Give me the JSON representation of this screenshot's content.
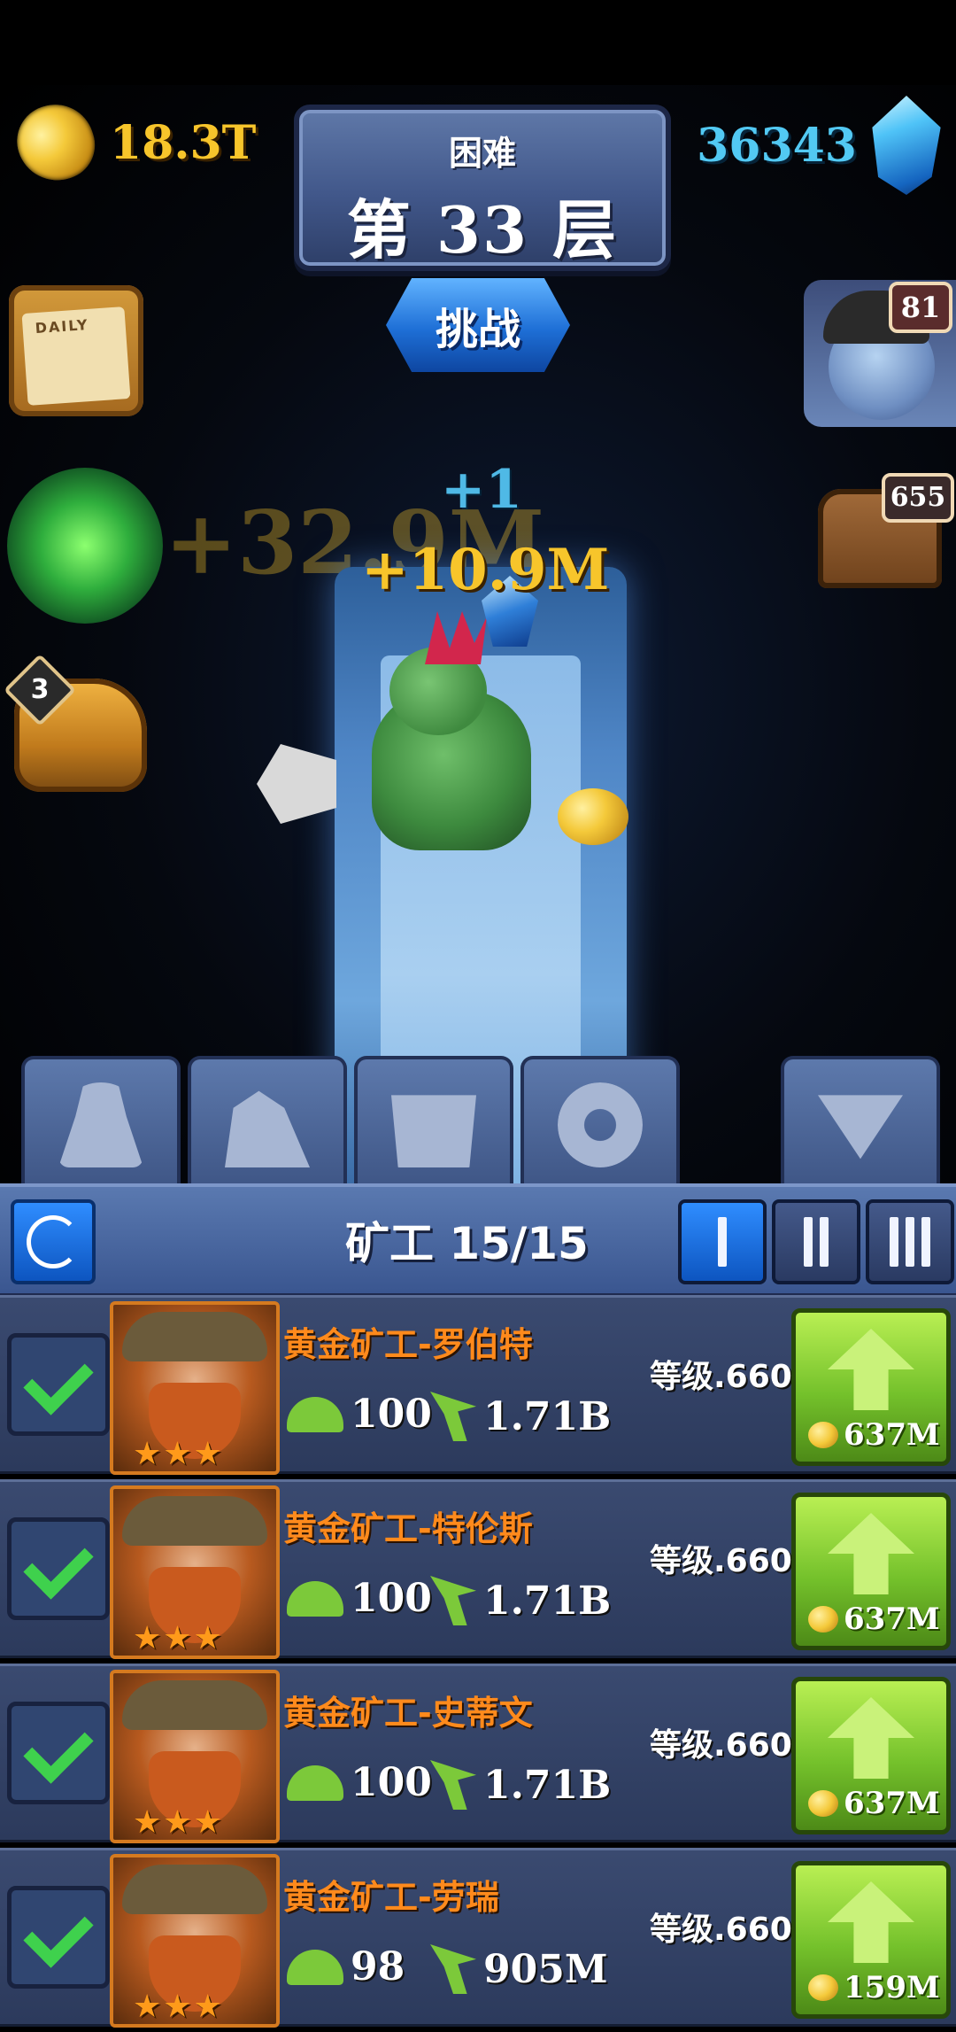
{
  "hud": {
    "gold_amount": "18.3T",
    "gem_amount": "36343",
    "difficulty": "困难",
    "floor": "第 33 层",
    "challenge_label": "挑战"
  },
  "side": {
    "calendar_label": "DAILY",
    "miner_avatar_badge": "81",
    "chest_right_badge": "655",
    "chest_left_badge": "3",
    "ghost_gold": "+32.9M"
  },
  "effects": {
    "plus_gem": "+1",
    "plus_gold": "+10.9M"
  },
  "panel": {
    "title": "矿工  15/15",
    "pages": [
      "I",
      "II",
      "III"
    ]
  },
  "miners": [
    {
      "name": "黄金矿工-罗伯特",
      "helmet": "100",
      "pick": "1.71B",
      "level": "等级.660",
      "cost": "637M"
    },
    {
      "name": "黄金矿工-特伦斯",
      "helmet": "100",
      "pick": "1.71B",
      "level": "等级.660",
      "cost": "637M"
    },
    {
      "name": "黄金矿工-史蒂文",
      "helmet": "100",
      "pick": "1.71B",
      "level": "等级.660",
      "cost": "637M"
    },
    {
      "name": "黄金矿工-劳瑞",
      "helmet": "98",
      "pick": "905M",
      "level": "等级.660",
      "cost": "159M"
    }
  ],
  "stars": "★★★"
}
